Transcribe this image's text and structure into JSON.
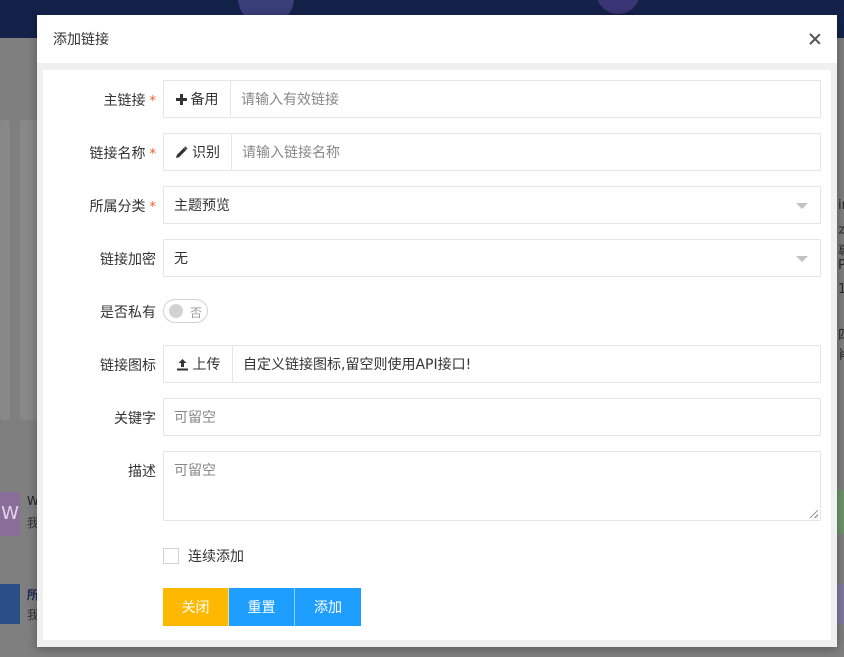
{
  "modal": {
    "title": "添加链接"
  },
  "form": {
    "main_link": {
      "label": "主链接",
      "required_mark": "*",
      "addon_label": "备用",
      "placeholder": "请输入有效链接"
    },
    "link_name": {
      "label": "链接名称",
      "required_mark": "*",
      "addon_label": "识别",
      "placeholder": "请输入链接名称"
    },
    "category": {
      "label": "所属分类",
      "required_mark": "*",
      "value": "主题预览"
    },
    "encryption": {
      "label": "链接加密",
      "value": "无"
    },
    "private": {
      "label": "是否私有",
      "switch_text": "否",
      "checked": false
    },
    "icon": {
      "label": "链接图标",
      "addon_label": "上传",
      "placeholder": "自定义链接图标,留空则使用API接口!"
    },
    "keywords": {
      "label": "关键字",
      "placeholder": "可留空"
    },
    "description": {
      "label": "描述",
      "placeholder": "可留空"
    },
    "continuous_add": {
      "label": "连续添加",
      "checked": false
    },
    "buttons": {
      "close": "关闭",
      "reset": "重置",
      "add": "添加"
    }
  },
  "background": {
    "tile_letter": "W",
    "tile_title": "W",
    "tile_subtitle": "我",
    "blue_tile_title": "所",
    "blue_tile_subtitle": "我",
    "right_fragments": [
      "in",
      "本",
      "專",
      "P",
      "1",
      "四",
      "肖"
    ]
  },
  "colors": {
    "accent_blue": "#1e9fff",
    "warn_yellow": "#ffb800",
    "required_red": "#ff5722"
  }
}
